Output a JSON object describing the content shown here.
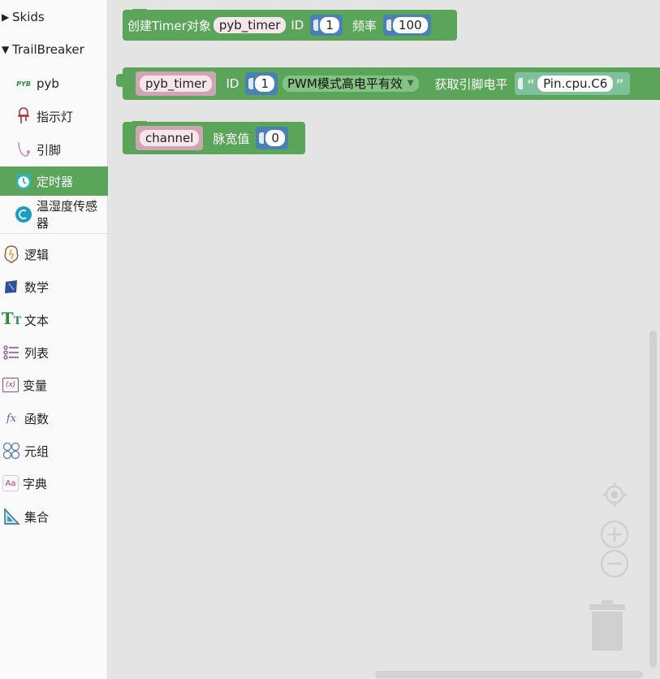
{
  "sidebar": {
    "items": [
      {
        "label": "Skids",
        "icon": "triangle-right-icon"
      },
      {
        "label": "TrailBreaker",
        "icon": "triangle-down-icon"
      },
      {
        "label": "pyb",
        "icon": "pyb-icon"
      },
      {
        "label": "指示灯",
        "icon": "led-icon"
      },
      {
        "label": "引脚",
        "icon": "pin-icon"
      },
      {
        "label": "定时器",
        "icon": "alarm-clock-icon"
      },
      {
        "label": "温湿度传感器",
        "icon": "sensor-icon"
      },
      {
        "label": "逻辑",
        "icon": "logic-icon"
      },
      {
        "label": "数学",
        "icon": "math-icon"
      },
      {
        "label": "文本",
        "icon": "text-icon"
      },
      {
        "label": "列表",
        "icon": "list-icon"
      },
      {
        "label": "变量",
        "icon": "variable-icon"
      },
      {
        "label": "函数",
        "icon": "function-icon"
      },
      {
        "label": "元组",
        "icon": "tuple-icon"
      },
      {
        "label": "字典",
        "icon": "dictionary-icon"
      },
      {
        "label": "集合",
        "icon": "set-icon"
      }
    ],
    "pyb_icon_text": "PYB",
    "var_icon_text": "(x)",
    "fn_icon_text": "fx",
    "dict_icon_text": "Aa",
    "text_icon_text": "T"
  },
  "workspace": {
    "block1": {
      "label": "创建Timer对象",
      "var": "pyb_timer",
      "id_label": "ID",
      "id_value": "1",
      "freq_label": "频率",
      "freq_value": "100"
    },
    "block2": {
      "var": "pyb_timer",
      "id_label": "ID",
      "id_value": "1",
      "mode": "PWM模式高电平有效",
      "pin_label": "获取引脚电平",
      "pin_value": "Pin.cpu.C6",
      "open_quote": "“",
      "close_quote": "”"
    },
    "block3": {
      "var": "channel",
      "label": "脉宽值",
      "value": "0"
    }
  },
  "colors": {
    "block_green": "#5ba55b",
    "selected_category": "#5ba55b",
    "workspace_bg": "#e4e4e4"
  }
}
